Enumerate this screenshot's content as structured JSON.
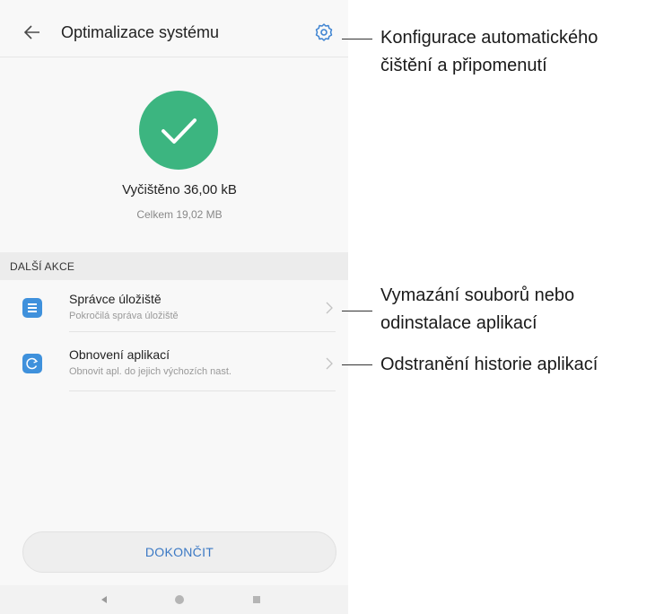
{
  "header": {
    "title": "Optimalizace systému",
    "back_icon": "arrow-left-icon",
    "settings_icon": "gear-icon"
  },
  "status": {
    "cleaned": "Vyčištěno 36,00 kB",
    "total": "Celkem 19,02 MB",
    "icon": "checkmark-icon",
    "accent_color": "#3cb580"
  },
  "section": {
    "label": "DALŠÍ AKCE"
  },
  "actions": [
    {
      "title": "Správce úložiště",
      "subtitle": "Pokročilá správa úložiště",
      "icon": "storage-icon"
    },
    {
      "title": "Obnovení aplikací",
      "subtitle": "Obnovit apl. do jejich výchozích nast.",
      "icon": "reset-icon"
    }
  ],
  "finish_button": {
    "label": "DOKONČIT",
    "text_color": "#3a78c4"
  },
  "callouts": [
    "Konfigurace automatického\nčištění a připomenutí",
    "Vymazání souborů nebo\nodinstalace aplikací",
    "Odstranění historie aplikací"
  ],
  "icon_color": "#3f91dc"
}
